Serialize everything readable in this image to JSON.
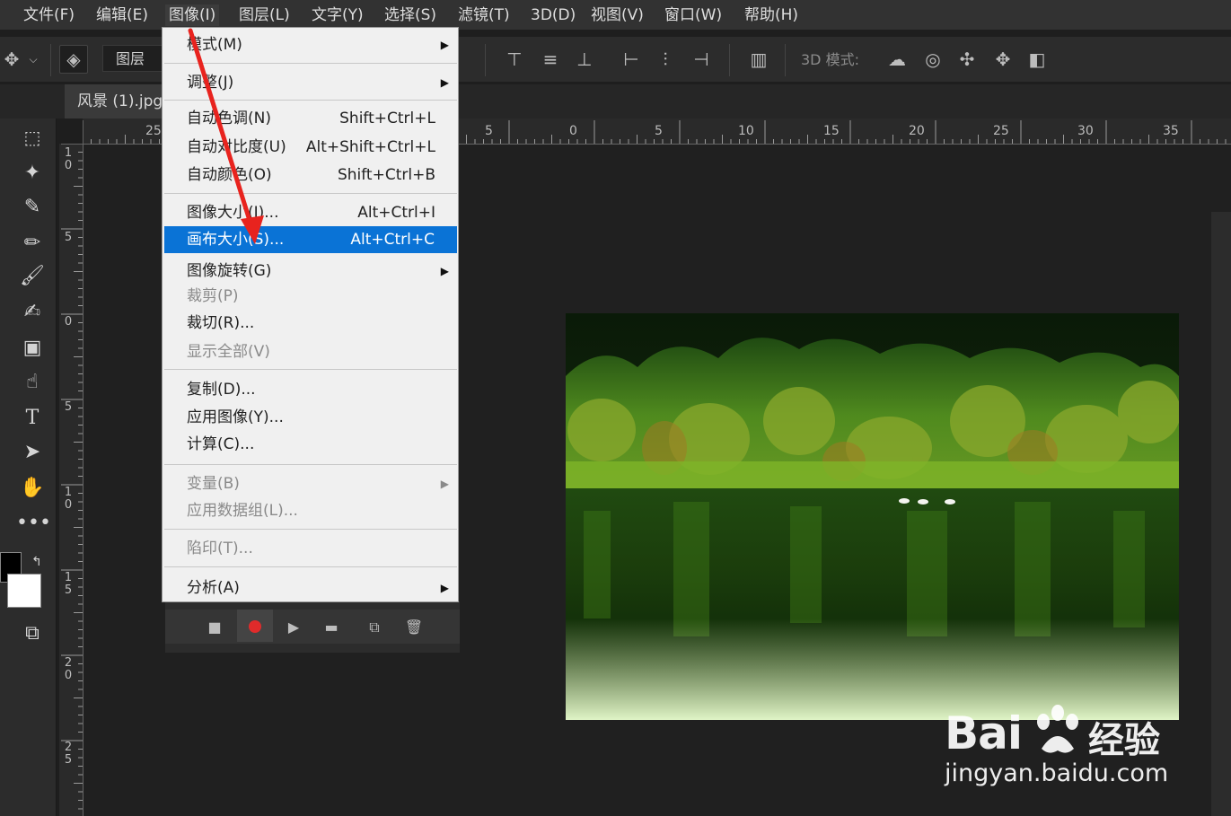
{
  "menubar": {
    "items": [
      "文件(F)",
      "编辑(E)",
      "图像(I)",
      "图层(L)",
      "文字(Y)",
      "选择(S)",
      "滤镜(T)",
      "3D(D)",
      "视图(V)",
      "窗口(W)",
      "帮助(H)"
    ]
  },
  "options": {
    "layer_select": "图层",
    "mode3d_label": "3D 模式:"
  },
  "document": {
    "tab_title": "风景 (1).jpg"
  },
  "ruler": {
    "h_labels": [
      "25",
      "5",
      "0",
      "5",
      "10",
      "15",
      "20",
      "25",
      "30",
      "35"
    ],
    "v_labels": [
      "1 0",
      "5",
      "0",
      "5",
      "1 0",
      "1 5",
      "2 0",
      "2 5"
    ]
  },
  "image_menu": {
    "mode": "模式(M)",
    "adjust": "调整(J)",
    "auto_tone": "自动色调(N)",
    "auto_tone_sc": "Shift+Ctrl+L",
    "auto_contrast": "自动对比度(U)",
    "auto_contrast_sc": "Alt+Shift+Ctrl+L",
    "auto_color": "自动颜色(O)",
    "auto_color_sc": "Shift+Ctrl+B",
    "image_size": "图像大小(I)...",
    "image_size_sc": "Alt+Ctrl+I",
    "canvas_size": "画布大小(S)...",
    "canvas_size_sc": "Alt+Ctrl+C",
    "rotation": "图像旋转(G)",
    "crop": "裁剪(P)",
    "trim": "裁切(R)...",
    "reveal_all": "显示全部(V)",
    "duplicate": "复制(D)...",
    "apply_image": "应用图像(Y)...",
    "calculations": "计算(C)...",
    "variables": "变量(B)",
    "apply_dataset": "应用数据组(L)...",
    "trap": "陷印(T)...",
    "analysis": "分析(A)"
  },
  "watermark": {
    "brand": "Bai",
    "brand_cn": "经验",
    "url": "jingyan.baidu.com"
  },
  "colors": {
    "highlight": "#0a73d6",
    "arrow": "#e8231e",
    "record": "#e02b2b"
  }
}
